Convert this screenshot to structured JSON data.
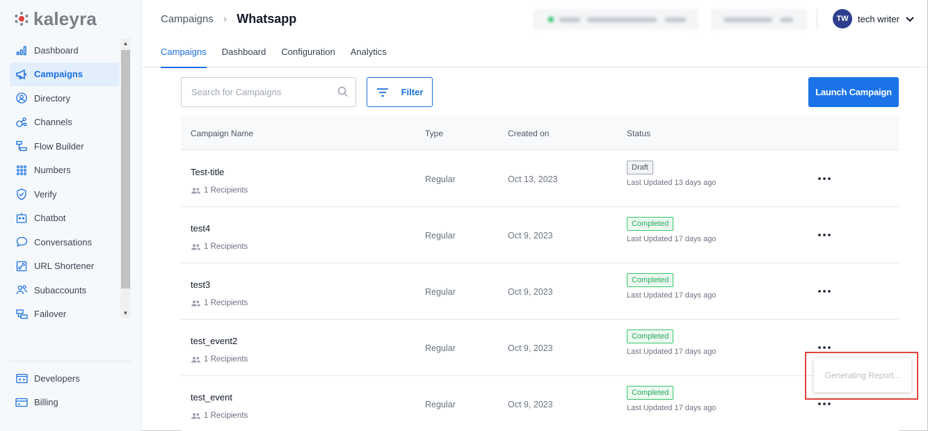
{
  "brand": {
    "name": "kaleyra",
    "accent": "#1a6fe0",
    "logo_color": "#e0413c"
  },
  "sidebar": {
    "items": [
      {
        "label": "Dashboard",
        "icon": "bar-chart-icon",
        "active": false
      },
      {
        "label": "Campaigns",
        "icon": "megaphone-icon",
        "active": true
      },
      {
        "label": "Directory",
        "icon": "contact-icon",
        "active": false
      },
      {
        "label": "Channels",
        "icon": "channels-icon",
        "active": false
      },
      {
        "label": "Flow Builder",
        "icon": "flow-icon",
        "active": false
      },
      {
        "label": "Numbers",
        "icon": "dialpad-icon",
        "active": false
      },
      {
        "label": "Verify",
        "icon": "shield-check-icon",
        "active": false
      },
      {
        "label": "Chatbot",
        "icon": "robot-icon",
        "active": false
      },
      {
        "label": "Conversations",
        "icon": "chat-bubble-icon",
        "active": false
      },
      {
        "label": "URL Shortener",
        "icon": "link-icon",
        "active": false
      },
      {
        "label": "Subaccounts",
        "icon": "users-icon",
        "active": false
      },
      {
        "label": "Failover",
        "icon": "failover-icon",
        "active": false
      }
    ],
    "bottom_items": [
      {
        "label": "Developers",
        "icon": "code-icon"
      },
      {
        "label": "Billing",
        "icon": "credit-card-icon"
      }
    ]
  },
  "header": {
    "breadcrumb_parent": "Campaigns",
    "breadcrumb_current": "Whatsapp",
    "user": {
      "initials": "TW",
      "name": "tech writer"
    },
    "tabs": [
      {
        "label": "Campaigns",
        "active": true
      },
      {
        "label": "Dashboard",
        "active": false
      },
      {
        "label": "Configuration",
        "active": false
      },
      {
        "label": "Analytics",
        "active": false
      }
    ]
  },
  "toolbar": {
    "search_placeholder": "Search for Campaigns",
    "search_value": "",
    "filter_label": "Filter",
    "launch_label": "Launch Campaign"
  },
  "table": {
    "columns": [
      "Campaign Name",
      "Type",
      "Created on",
      "Status"
    ],
    "rows": [
      {
        "name": "Test-title",
        "recipients": "1 Recipients",
        "type": "Regular",
        "created": "Oct 13, 2023",
        "status": "Draft",
        "status_kind": "draft",
        "updated": "Last Updated 13 days ago"
      },
      {
        "name": "test4",
        "recipients": "1 Recipients",
        "type": "Regular",
        "created": "Oct 9, 2023",
        "status": "Completed",
        "status_kind": "completed",
        "updated": "Last Updated 17 days ago"
      },
      {
        "name": "test3",
        "recipients": "1 Recipients",
        "type": "Regular",
        "created": "Oct 9, 2023",
        "status": "Completed",
        "status_kind": "completed",
        "updated": "Last Updated 17 days ago"
      },
      {
        "name": "test_event2",
        "recipients": "1 Recipients",
        "type": "Regular",
        "created": "Oct 9, 2023",
        "status": "Completed",
        "status_kind": "completed",
        "updated": "Last Updated 17 days ago"
      },
      {
        "name": "test_event",
        "recipients": "1 Recipients",
        "type": "Regular",
        "created": "Oct 9, 2023",
        "status": "Completed",
        "status_kind": "completed",
        "updated": "Last Updated 17 days ago"
      }
    ]
  },
  "popover": {
    "text": "Generating Report..."
  }
}
